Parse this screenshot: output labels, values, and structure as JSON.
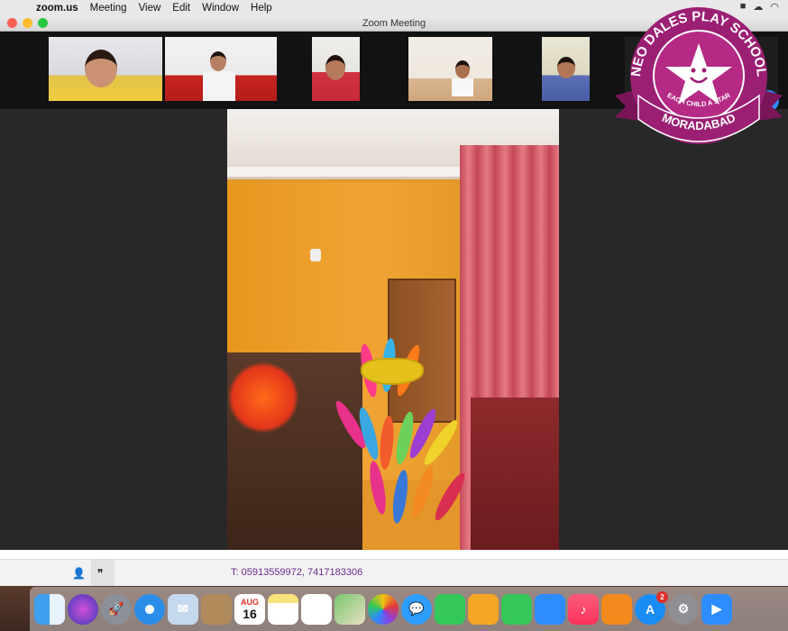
{
  "menubar": {
    "app_name": "zoom.us",
    "items": [
      "Meeting",
      "View",
      "Edit",
      "Window",
      "Help"
    ]
  },
  "window": {
    "title": "Zoom Meeting"
  },
  "participants_strip": {
    "count_visible": 6
  },
  "overlay_logo": {
    "school_name": "NEO DALES PLAY SCHOOL",
    "tagline": "EACH CHILD A STAR",
    "city": "MORADABAD",
    "brand_color": "#9b1f73"
  },
  "contact": {
    "phone_text": "T:   05913559972, 7417183306"
  },
  "dock": {
    "calendar_month": "AUG",
    "calendar_day": "16",
    "appstore_badge": "2",
    "items": [
      "finder-icon",
      "siri-icon",
      "launchpad-icon",
      "safari-icon",
      "mail-icon",
      "contacts-icon",
      "calendar-icon",
      "notes-icon",
      "reminders-icon",
      "maps-icon",
      "photos-icon",
      "messages-icon",
      "facetime-icon",
      "pages-icon",
      "numbers-icon",
      "keynote-icon",
      "music-icon",
      "books-icon",
      "appstore-icon",
      "system-preferences-icon",
      "zoom-icon"
    ]
  }
}
